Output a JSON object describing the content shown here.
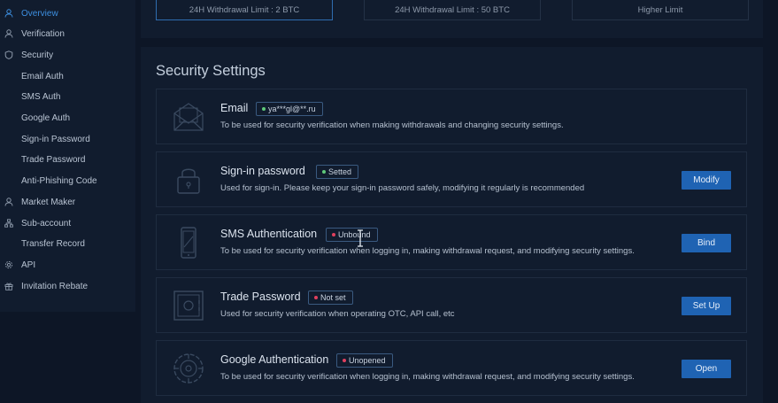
{
  "sidebar": {
    "items": [
      {
        "label": "Overview",
        "icon": "user-icon",
        "active": true
      },
      {
        "label": "Verification",
        "icon": "user-icon"
      },
      {
        "label": "Security",
        "icon": "shield-icon"
      },
      {
        "label": "Email Auth"
      },
      {
        "label": "SMS Auth"
      },
      {
        "label": "Google Auth"
      },
      {
        "label": "Sign-in Password"
      },
      {
        "label": "Trade Password"
      },
      {
        "label": "Anti-Phishing Code"
      },
      {
        "label": "Market Maker",
        "icon": "user-icon"
      },
      {
        "label": "Sub-account",
        "icon": "sitemap-icon"
      },
      {
        "label": "Transfer Record"
      },
      {
        "label": "API",
        "icon": "gear-icon"
      },
      {
        "label": "Invitation Rebate",
        "icon": "gift-icon"
      }
    ]
  },
  "limits": [
    {
      "text": "24H Withdrawal Limit : 2 BTC"
    },
    {
      "text": "24H Withdrawal Limit : 50 BTC"
    },
    {
      "text": "Higher Limit"
    }
  ],
  "security": {
    "title": "Security Settings",
    "rows": [
      {
        "name": "Email",
        "badge": "ya***gl@**.ru",
        "dot": "#5fc97a",
        "desc": "To be used for security verification when making withdrawals and changing security settings.",
        "icon": "envelope-icon"
      },
      {
        "name": "Sign-in password",
        "badge": "Setted",
        "dot": "#5fc97a",
        "desc": "Used for sign-in. Please keep your sign-in password safely, modifying it regularly is recommended",
        "action": "Modify",
        "icon": "lock-icon"
      },
      {
        "name": "SMS Authentication",
        "badge": "Unbound",
        "dot": "#e0405e",
        "desc": "To be used for security verification when logging in, making withdrawal request, and modifying security settings.",
        "action": "Bind",
        "icon": "phone-icon"
      },
      {
        "name": "Trade Password",
        "badge": "Not set",
        "dot": "#e0405e",
        "desc": "Used for security verification when operating OTC, API call, etc",
        "action": "Set Up",
        "icon": "safe-icon"
      },
      {
        "name": "Google Authentication",
        "badge": "Unopened",
        "dot": "#e0405e",
        "desc": "To be used for security verification when logging in, making withdrawal request, and modifying security settings.",
        "action": "Open",
        "icon": "google-auth-icon"
      }
    ]
  },
  "colors": {
    "accent": "#1f63b3",
    "active_nav": "#3d8fe0",
    "ok": "#5fc97a",
    "warn": "#e0405e"
  }
}
